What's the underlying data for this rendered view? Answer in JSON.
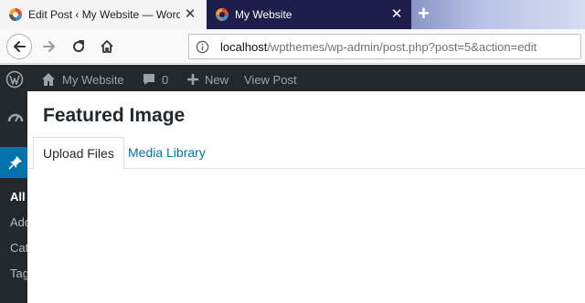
{
  "browser": {
    "tabs": [
      {
        "title": "Edit Post ‹ My Website — Word",
        "active": true,
        "close": "✕",
        "icon": "wordpress-favicon-icon"
      },
      {
        "title": "My Website",
        "active": false,
        "close": "✕",
        "icon": "wordpress-favicon-icon"
      }
    ],
    "new_tab": "+",
    "url": {
      "host": "localhost",
      "path": "/wpthemes/wp-admin/post.php?post=5&action=edit"
    }
  },
  "adminbar": {
    "site_name": "My Website",
    "comments_count": "0",
    "new_label": "New",
    "view_post_label": "View Post"
  },
  "sidebar": {
    "submenu": [
      "All",
      "Add",
      "Cat",
      "Tag"
    ]
  },
  "modal": {
    "title": "Featured Image",
    "tabs": [
      "Upload Files",
      "Media Library"
    ]
  },
  "colors": {
    "tabstrip": "#1d1e4c",
    "adminbar": "#23282d",
    "accent": "#0073aa"
  }
}
